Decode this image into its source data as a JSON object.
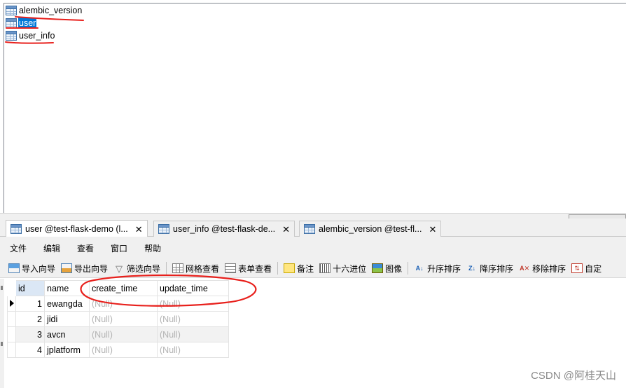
{
  "objects": [
    {
      "name": "alembic_version",
      "selected": false
    },
    {
      "name": "user",
      "selected": true
    },
    {
      "name": "user_info",
      "selected": false
    }
  ],
  "tabs": [
    {
      "label": "user @test-flask-demo (l...",
      "active": true
    },
    {
      "label": "user_info @test-flask-de...",
      "active": false
    },
    {
      "label": "alembic_version @test-fl...",
      "active": false
    }
  ],
  "tab_close": "✕",
  "menu": [
    "文件",
    "编辑",
    "查看",
    "窗口",
    "帮助"
  ],
  "toolbar": {
    "import": "导入向导",
    "export": "导出向导",
    "filter": "筛选向导",
    "grid_view": "网格查看",
    "form_view": "表单查看",
    "memo": "备注",
    "hex": "十六进位",
    "image": "图像",
    "sort_asc": "升序排序",
    "sort_desc": "降序排序",
    "remove_sort": "移除排序",
    "auto": "自定"
  },
  "table": {
    "columns": [
      "id",
      "name",
      "create_time",
      "update_time"
    ],
    "rows": [
      [
        "1",
        "ewangda",
        "(Null)",
        "(Null)"
      ],
      [
        "2",
        "jidi",
        "(Null)",
        "(Null)"
      ],
      [
        "3",
        "avcn",
        "(Null)",
        "(Null)"
      ],
      [
        "4",
        "jplatform",
        "(Null)",
        "(Null)"
      ]
    ]
  },
  "annotation_colors": {
    "pen": "#e8201c"
  },
  "watermark": "CSDN @阿桂天山"
}
